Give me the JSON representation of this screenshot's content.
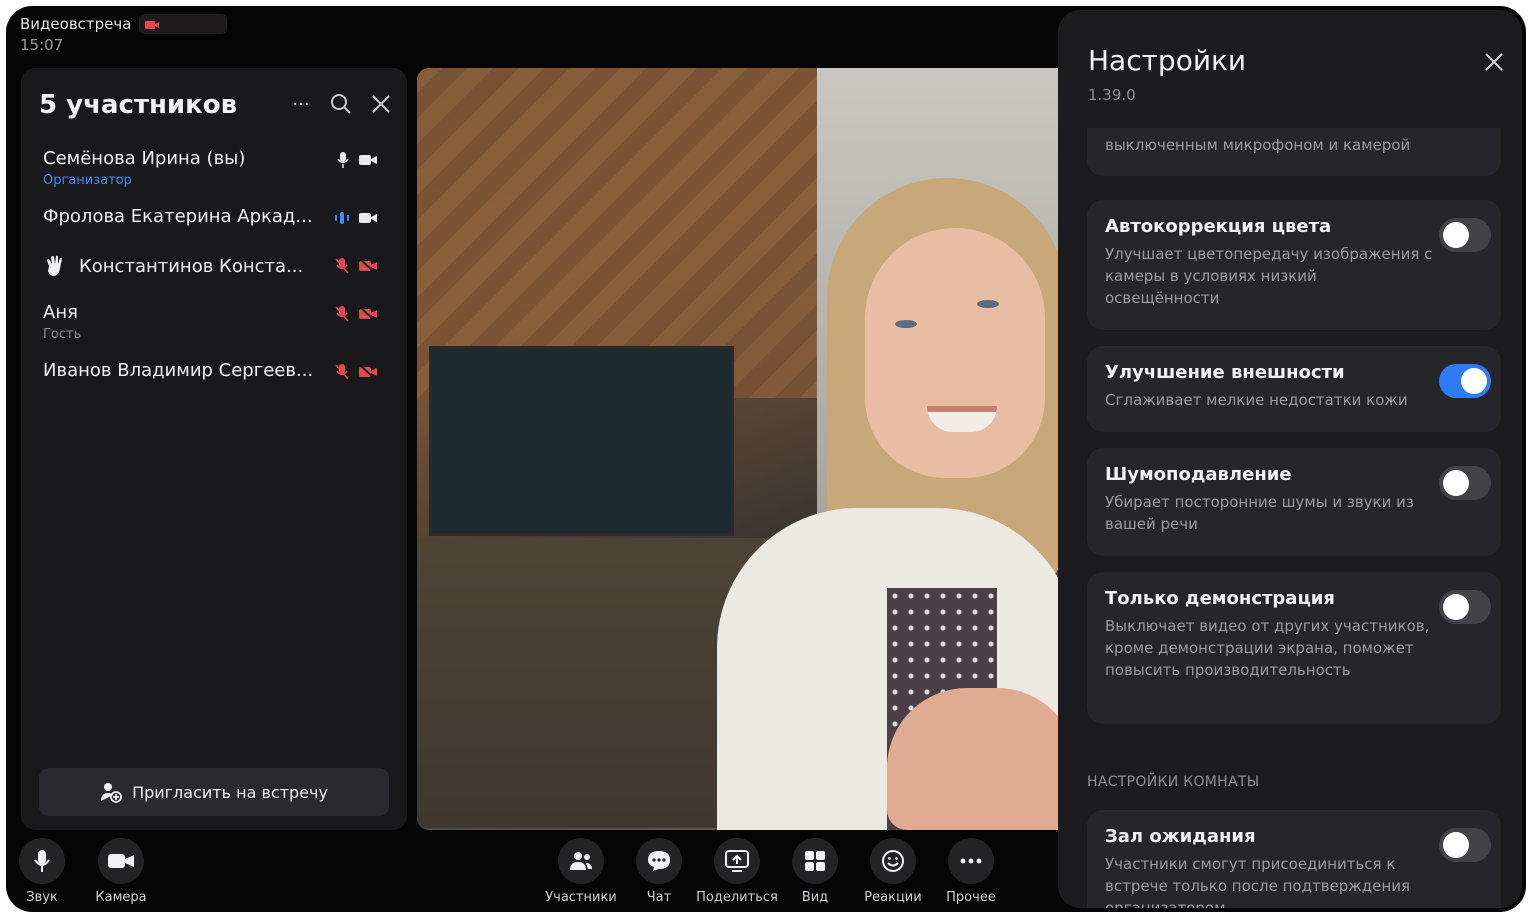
{
  "meeting": {
    "title": "Видеовстреча",
    "time": "15:07"
  },
  "participants_panel": {
    "title": "5 участников",
    "more_label": "···",
    "invite_label": "Пригласить на встречу",
    "items": [
      {
        "name": "Семёнова Ирина (вы)",
        "role": "Организатор",
        "mic": "on",
        "cam": "on"
      },
      {
        "name": "Фролова Екатерина Аркад...",
        "role": "",
        "mic": "speaking",
        "cam": "on"
      },
      {
        "name": "Константинов Конста...",
        "role": "",
        "mic": "off",
        "cam": "off",
        "hand_raised": true
      },
      {
        "name": "Аня",
        "role": "Гость",
        "mic": "off",
        "cam": "off"
      },
      {
        "name": "Иванов Владимир Сергеев...",
        "role": "",
        "mic": "off",
        "cam": "off"
      }
    ]
  },
  "controls_left": [
    {
      "label": "Звук",
      "icon": "microphone-icon"
    },
    {
      "label": "Камера",
      "icon": "camera-icon"
    }
  ],
  "toolbar": {
    "participants": "Участники",
    "chat": "Чат",
    "share": "Поделиться",
    "view": "Вид",
    "reactions": "Реакции",
    "more": "Прочее"
  },
  "settings": {
    "title": "Настройки",
    "version": "1.39.0",
    "partial_card_desc": "выключенным микрофоном и камерой",
    "items": [
      {
        "title": "Автокоррекция цвета",
        "desc": "Улучшает цветопередачу изображения с камеры в условиях низкий освещённости",
        "enabled": false
      },
      {
        "title": "Улучшение внешности",
        "desc": "Сглаживает мелкие недостатки кожи",
        "enabled": true
      },
      {
        "title": "Шумоподавление",
        "desc": "Убирает посторонние шумы и звуки из вашей речи",
        "enabled": false
      },
      {
        "title": "Только демонстрация",
        "desc": "Выключает видео от других участников, кроме демонстрации экрана, поможет повысить производительность",
        "enabled": false
      }
    ],
    "room_section": "НАСТРОЙКИ КОМНАТЫ",
    "room_items": [
      {
        "title": "Зал ожидания",
        "desc": "Участники смогут присоединиться к встрече только после подтверждения организатором",
        "enabled": false
      }
    ]
  },
  "colors": {
    "accent": "#2f7bf5",
    "muted_red": "#e5484d",
    "organizer_blue": "#3d8bf5"
  }
}
